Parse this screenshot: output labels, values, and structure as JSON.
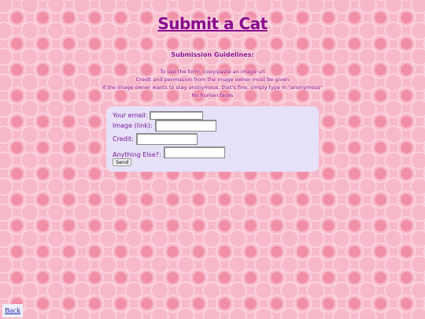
{
  "page": {
    "title": "Submit a Cat"
  },
  "guidelines": {
    "heading": "Submission Guidelines:",
    "lines": [
      "To use the form, copy/paste an image url",
      "Credit and permission from the image owner must be given",
      "If the image owner wants to stay anonymous, that's fine, simply type in \"anonymous\"",
      "No human faces"
    ]
  },
  "form": {
    "email_label": "Your email:",
    "email_value": "",
    "image_label": "Image (link):",
    "image_value": "",
    "credit_label": "Credit:",
    "credit_value": "",
    "else_label": "Anything Else?:",
    "else_value": "",
    "send_label": "Send"
  },
  "nav": {
    "back_label": "Back"
  },
  "colors": {
    "title": "#8a0a8e",
    "form_bg": "#e6e0f8",
    "background": "#f7b9c9"
  }
}
